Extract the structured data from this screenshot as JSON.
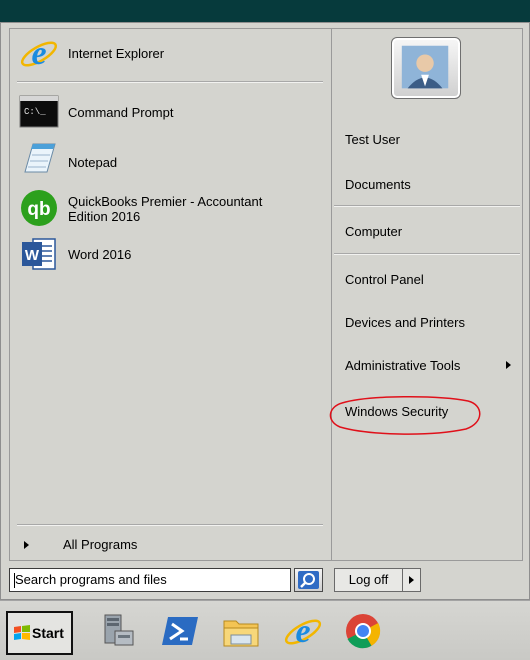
{
  "pinned": [
    {
      "label": "Internet Explorer",
      "icon": "internet-explorer-icon"
    },
    {
      "label": "Command Prompt",
      "icon": "command-prompt-icon",
      "icon_text": "C:\\_"
    },
    {
      "label": "Notepad",
      "icon": "notepad-icon"
    },
    {
      "label": "QuickBooks Premier - Accountant Edition 2016",
      "line1": "QuickBooks Premier - Accountant",
      "line2": "Edition 2016",
      "icon": "quickbooks-icon",
      "icon_text": "qb"
    },
    {
      "label": "Word 2016",
      "icon": "word-icon",
      "icon_text": "W"
    }
  ],
  "all_programs": "All Programs",
  "search": {
    "placeholder": "Search programs and files"
  },
  "right_items": [
    "Test User",
    "Documents",
    "Computer",
    "Control Panel",
    "Devices and Printers",
    "Administrative Tools",
    "Windows Security"
  ],
  "logoff_label": "Log off",
  "start_label": "Start",
  "colors": {
    "highlight_circle": "#e0101a",
    "quickbooks_green": "#2ca01c",
    "word_blue": "#2b579a",
    "ie_blue": "#1a8be0"
  },
  "taskbar_icons": [
    "server-manager-icon",
    "powershell-icon",
    "file-explorer-icon",
    "internet-explorer-icon",
    "chrome-icon"
  ]
}
